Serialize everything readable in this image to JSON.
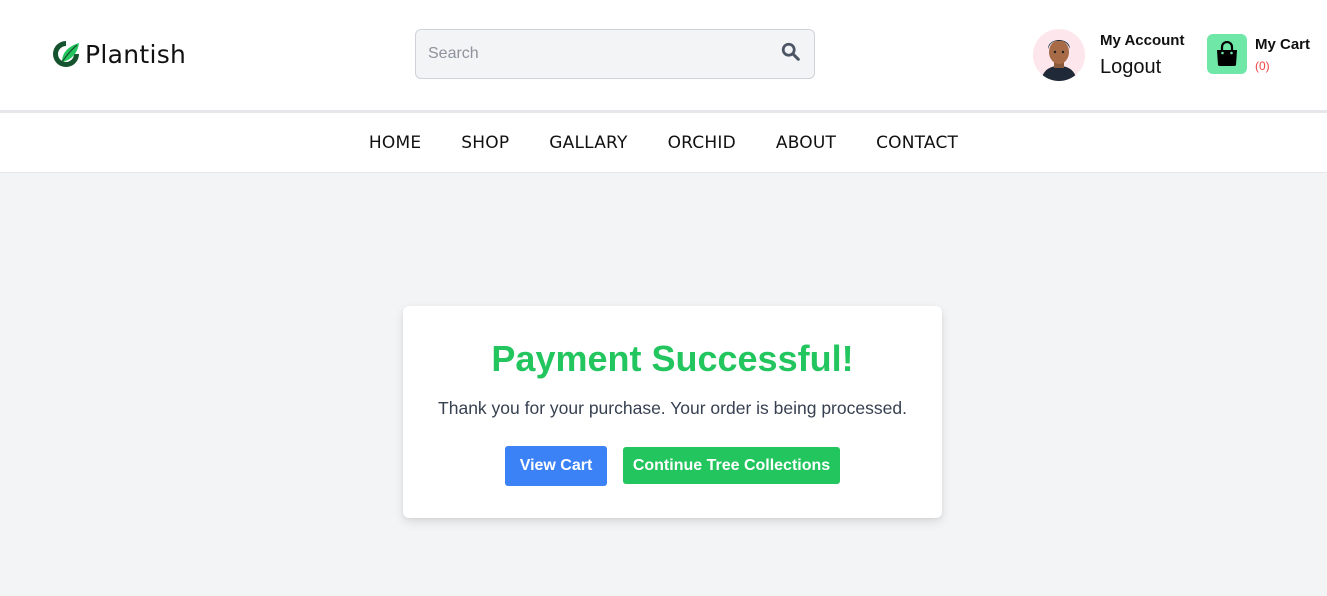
{
  "header": {
    "brand": "Plantish",
    "search": {
      "placeholder": "Search",
      "value": ""
    },
    "account": {
      "title": "My Account",
      "logout_label": "Logout"
    },
    "cart": {
      "title": "My Cart",
      "count": "(0)"
    }
  },
  "nav": {
    "items": [
      {
        "label": "HOME"
      },
      {
        "label": "SHOP"
      },
      {
        "label": "GALLARY"
      },
      {
        "label": "ORCHID"
      },
      {
        "label": "ABOUT"
      },
      {
        "label": "CONTACT"
      }
    ]
  },
  "main": {
    "title": "Payment Successful!",
    "message": "Thank you for your purchase. Your order is being processed.",
    "view_cart_label": "View Cart",
    "continue_label": "Continue Tree Collections"
  },
  "icons": {
    "logo": "leaf-logo-icon",
    "search": "search-icon",
    "cart": "shopping-bag-icon",
    "avatar": "user-avatar"
  },
  "colors": {
    "success": "#22c55e",
    "primary": "#3b82f6",
    "cart_badge_bg": "#6ee7a7",
    "cart_count": "#ef4444",
    "page_bg": "#f3f4f6"
  }
}
